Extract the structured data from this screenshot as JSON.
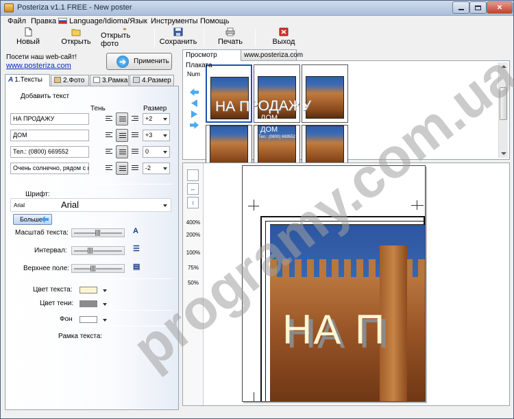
{
  "window": {
    "title": "Posteriza v1.1 FREE - New poster",
    "controls": [
      "minimize",
      "maximize",
      "close"
    ]
  },
  "menu": [
    "Файл",
    "Правка",
    "Language/Idioma/Язык",
    "Инструменты",
    "Помощь"
  ],
  "toolbar": {
    "new": "Новый",
    "open": "Открыть",
    "open_photo": "Открыть фото",
    "save": "Сохранить",
    "print": "Печать",
    "exit": "Выход"
  },
  "promo": {
    "text": "Посети наш web-сайт!",
    "link": "www.posteriza.com"
  },
  "apply_button": "Применить",
  "tabs": [
    "1.Тексты",
    "2.Фото",
    "3.Рамка",
    "4.Размер"
  ],
  "text_tab": {
    "add_text": "Добавить текст",
    "shadow_header": "Тень",
    "size_header": "Размер",
    "lines": [
      {
        "value": "НА ПРОДАЖУ",
        "size": "+2"
      },
      {
        "value": "ДОМ",
        "size": "+3"
      },
      {
        "value": "Тел.: (0800) 669552",
        "size": "0"
      },
      {
        "value": "Очень солнечно, рядом с ш",
        "size": "-2"
      }
    ],
    "font_label": "Шрифт:",
    "font_name_small": "Arial",
    "font_name_preview": "Arial",
    "more_button": "Больше",
    "sliders": [
      {
        "label": "Масштаб текста:",
        "icon": "text-scale-icon",
        "value": 0.48
      },
      {
        "label": "Интервал:",
        "icon": "line-spacing-icon",
        "value": 0.32
      },
      {
        "label": "Верхнее поле:",
        "icon": "top-margin-icon",
        "value": 0.38
      }
    ],
    "colors": [
      {
        "label": "Цвет текста:",
        "color": "#fdf5d0"
      },
      {
        "label": "Цвет тени:",
        "color": "#8c8c8c"
      },
      {
        "label": "Фон",
        "color": "#ffffff"
      }
    ],
    "frame_label": "Рамка текста:"
  },
  "right": {
    "tabs": [
      "Просмотр Плаката",
      "www.posteriza.com"
    ],
    "num_label": "Num",
    "thumb_texts": {
      "big": "НА ПРОДАЖУ",
      "line2": "ДОМ",
      "line3": "Тел.: (0800) 669552"
    },
    "zoom_levels": [
      "400%",
      "200%",
      "100%",
      "75%",
      "50%"
    ],
    "poster_big_text": "НА П"
  },
  "watermark": "programy.com.ua",
  "colors": {
    "link": "#0a27c9",
    "selection": "#1c4fb3",
    "accent_blue": "#4da8f0"
  }
}
